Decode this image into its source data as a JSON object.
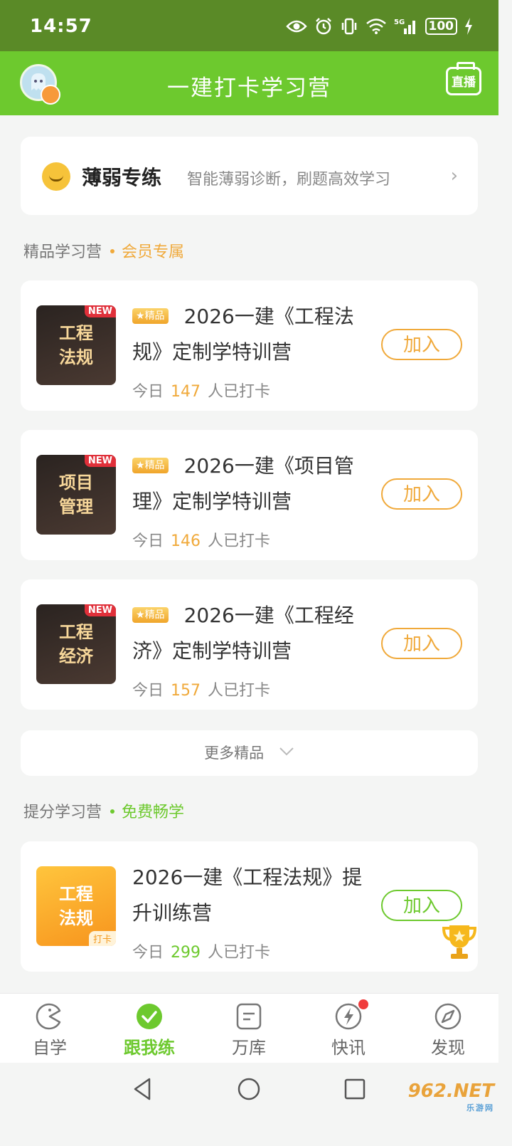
{
  "status_bar": {
    "time": "14:57",
    "network": "5G",
    "battery": "100"
  },
  "header": {
    "title": "一建打卡学习营",
    "live_label": "直播"
  },
  "weak_practice": {
    "title": "薄弱专练",
    "description": "智能薄弱诊断，刷题高效学习"
  },
  "premium_section": {
    "title": "精品学习营",
    "tag": "会员专属",
    "tag_color": "#f0a93a"
  },
  "premium_courses": [
    {
      "thumb_line1": "工程",
      "thumb_line2": "法规",
      "new_label": "NEW",
      "badge": "精品",
      "title": "2026一建《工程法规》定制学特训营",
      "count_prefix": "今日",
      "count": "147",
      "count_suffix": "人已打卡",
      "join_label": "加入"
    },
    {
      "thumb_line1": "项目",
      "thumb_line2": "管理",
      "new_label": "NEW",
      "badge": "精品",
      "title": "2026一建《项目管理》定制学特训营",
      "count_prefix": "今日",
      "count": "146",
      "count_suffix": "人已打卡",
      "join_label": "加入"
    },
    {
      "thumb_line1": "工程",
      "thumb_line2": "经济",
      "new_label": "NEW",
      "badge": "精品",
      "title": "2026一建《工程经济》定制学特训营",
      "count_prefix": "今日",
      "count": "157",
      "count_suffix": "人已打卡",
      "join_label": "加入"
    }
  ],
  "more_label": "更多精品",
  "free_section": {
    "title": "提分学习营",
    "tag": "免费畅学",
    "tag_color": "#6dc92e"
  },
  "free_courses": [
    {
      "thumb_line1": "工程",
      "thumb_line2": "法规",
      "tag": "打卡",
      "title": "2026一建《工程法规》提升训练营",
      "count_prefix": "今日",
      "count": "299",
      "count_suffix": "人已打卡",
      "join_label": "加入"
    }
  ],
  "tabs": [
    {
      "label": "自学",
      "icon": "pacman-icon",
      "active": false
    },
    {
      "label": "跟我练",
      "icon": "check-circle-icon",
      "active": true
    },
    {
      "label": "万库",
      "icon": "document-icon",
      "active": false
    },
    {
      "label": "快讯",
      "icon": "lightning-icon",
      "active": false,
      "dot": true
    },
    {
      "label": "发现",
      "icon": "compass-icon",
      "active": false
    }
  ],
  "watermark": {
    "brand": "962.NET",
    "sub": "乐游网"
  },
  "colors": {
    "header_green": "#6dc92e",
    "status_green": "#5a8a27",
    "gold": "#f0a93a",
    "active_tab": "#6dc92e"
  }
}
